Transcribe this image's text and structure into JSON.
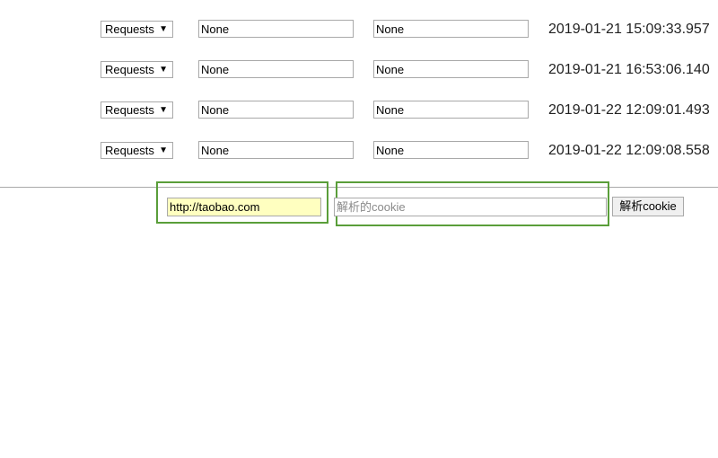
{
  "history": {
    "rows": [
      {
        "method": "Requests",
        "field1": "None",
        "field2": "None",
        "time": "2019-01-21 15:09:33.957"
      },
      {
        "method": "Requests",
        "field1": "None",
        "field2": "None",
        "time": "2019-01-21 16:53:06.140"
      },
      {
        "method": "Requests",
        "field1": "None",
        "field2": "None",
        "time": "2019-01-22 12:09:01.493"
      },
      {
        "method": "Requests",
        "field1": "None",
        "field2": "None",
        "time": "2019-01-22 12:09:08.558"
      }
    ],
    "dropdown_arrow": "▼"
  },
  "form": {
    "url_value": "http://taobao.com",
    "cookie_placeholder": "解析的cookie",
    "parse_button_label": "解析cookie"
  },
  "colors": {
    "highlight_border": "#5a9e3a",
    "url_input_bg": "#ffffc0"
  }
}
